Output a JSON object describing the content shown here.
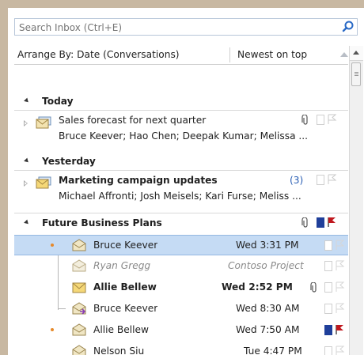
{
  "search": {
    "placeholder": "Search Inbox (Ctrl+E)"
  },
  "arrange": {
    "by": "Arrange By: Date (Conversations)",
    "order": "Newest on top"
  },
  "groups": {
    "today": "Today",
    "yesterday": "Yesterday",
    "future": "Future Business Plans"
  },
  "messages": [
    {
      "subject": "Sales forecast for next quarter",
      "people": "Bruce Keever; Hao Chen; Deepak Kumar; Melissa ..."
    },
    {
      "subject": "Marketing campaign updates",
      "count": "(3)",
      "people": "Michael Affronti; Josh Meisels; Kari Furse; Meliss ..."
    }
  ],
  "thread": [
    {
      "sender": "Bruce Keever",
      "meta": "Wed 3:31 PM"
    },
    {
      "sender": "Ryan Gregg",
      "meta": "Contoso Project"
    },
    {
      "sender": "Allie Bellew",
      "meta": "Wed 2:52 PM"
    },
    {
      "sender": "Bruce Keever",
      "meta": "Wed 8:30 AM"
    },
    {
      "sender": "Allie Bellew",
      "meta": "Wed 7:50 AM"
    },
    {
      "sender": "Nelson Siu",
      "meta": "Tue 4:47 PM"
    }
  ],
  "colors": {
    "selection": "#c5dbf4",
    "unread_count": "#2a5fb4",
    "flag_red": "#c0181e",
    "category_blue": "#1f3f9a",
    "thread_dot": "#e6892a"
  }
}
